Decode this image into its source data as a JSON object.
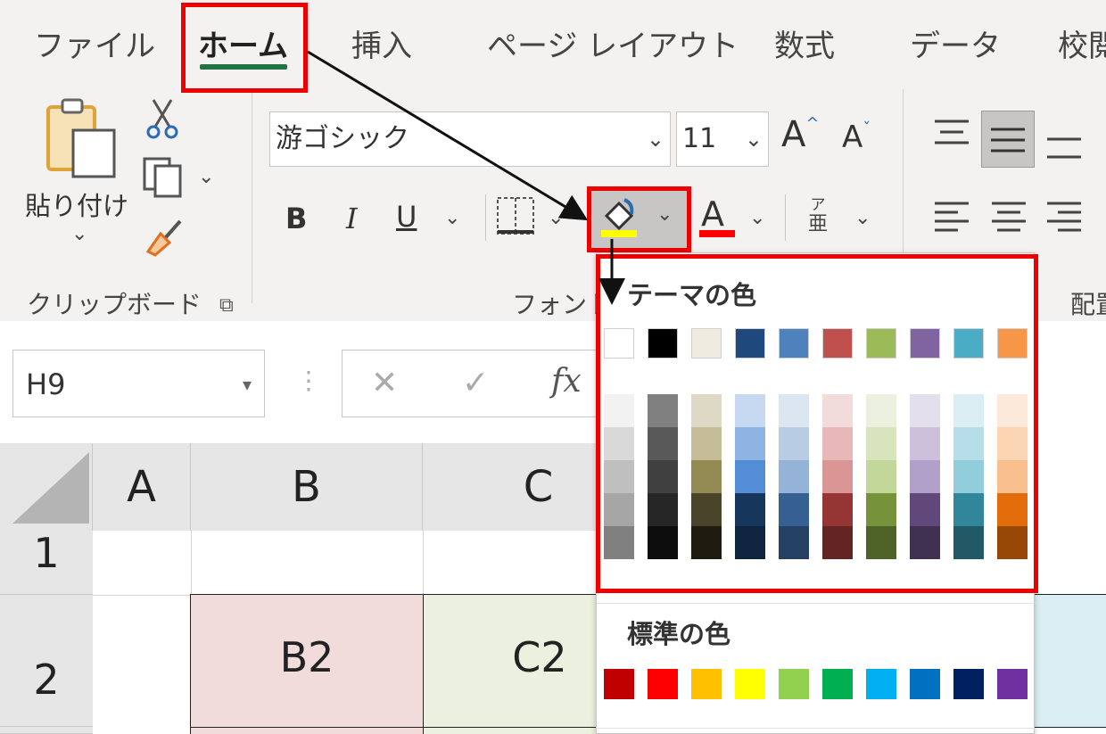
{
  "tabs": [
    "ファイル",
    "ホーム",
    "挿入",
    "ページ レイアウト",
    "数式",
    "データ",
    "校閲"
  ],
  "clipboard": {
    "paste_label": "貼り付け",
    "group_label": "クリップボード"
  },
  "font": {
    "name": "游ゴシック",
    "size": "11",
    "group_label": "フォント",
    "bold": "B",
    "italic": "I",
    "underline": "U",
    "font_color_letter": "A",
    "phonetic_top": "ア",
    "phonetic_bottom": "亜",
    "grow": "A",
    "shrink": "A"
  },
  "align_group_label": "配置",
  "namebox": "H9",
  "formula_bar": {
    "cancel": "✕",
    "enter": "✓",
    "fx": "fx"
  },
  "columns": [
    "A",
    "B",
    "C"
  ],
  "rows": [
    "1",
    "2"
  ],
  "cells": {
    "b2": "B2",
    "c2": "C2"
  },
  "palette": {
    "theme_title": "テーマの色",
    "standard_title": "標準の色",
    "theme_colors": [
      "#FFFFFF",
      "#000000",
      "#EEECE1",
      "#1F497D",
      "#4F81BD",
      "#C0504D",
      "#9BBB59",
      "#8064A2",
      "#4BACC6",
      "#F79646"
    ],
    "theme_shades": [
      [
        "#F2F2F2",
        "#D9D9D9",
        "#BFBFBF",
        "#A6A6A6",
        "#808080"
      ],
      [
        "#808080",
        "#595959",
        "#404040",
        "#262626",
        "#0D0D0D"
      ],
      [
        "#DDD9C4",
        "#C4BD97",
        "#948A54",
        "#4A452A",
        "#1E1C11"
      ],
      [
        "#C6D9F1",
        "#8DB4E2",
        "#538DD5",
        "#16365C",
        "#0F243E"
      ],
      [
        "#DCE6F1",
        "#B8CCE4",
        "#95B3D7",
        "#366092",
        "#244062"
      ],
      [
        "#F2DCDB",
        "#E6B8B7",
        "#DA9694",
        "#963634",
        "#632523"
      ],
      [
        "#EBF1DE",
        "#D8E4BC",
        "#C4D79B",
        "#76933C",
        "#4F6228"
      ],
      [
        "#E4DFEC",
        "#CCC0DA",
        "#B1A0C7",
        "#60497A",
        "#403151"
      ],
      [
        "#DAEEF3",
        "#B7DEE8",
        "#92CDDC",
        "#31869B",
        "#215967"
      ],
      [
        "#FDE9D9",
        "#FCD5B4",
        "#FABF8F",
        "#E26B0A",
        "#974706"
      ]
    ],
    "standard_colors": [
      "#C00000",
      "#FF0000",
      "#FFC000",
      "#FFFF00",
      "#92D050",
      "#00B050",
      "#00B0F0",
      "#0070C0",
      "#002060",
      "#7030A0"
    ]
  },
  "colors": {
    "accent_green": "#217346",
    "highlight_red": "#EE0000",
    "fill_yellow": "#FFFF00",
    "font_red": "#FF0000",
    "cell_b2": "#F2DCDB",
    "cell_c2": "#EBF1DE",
    "cell_right": "#DAEEF3"
  }
}
